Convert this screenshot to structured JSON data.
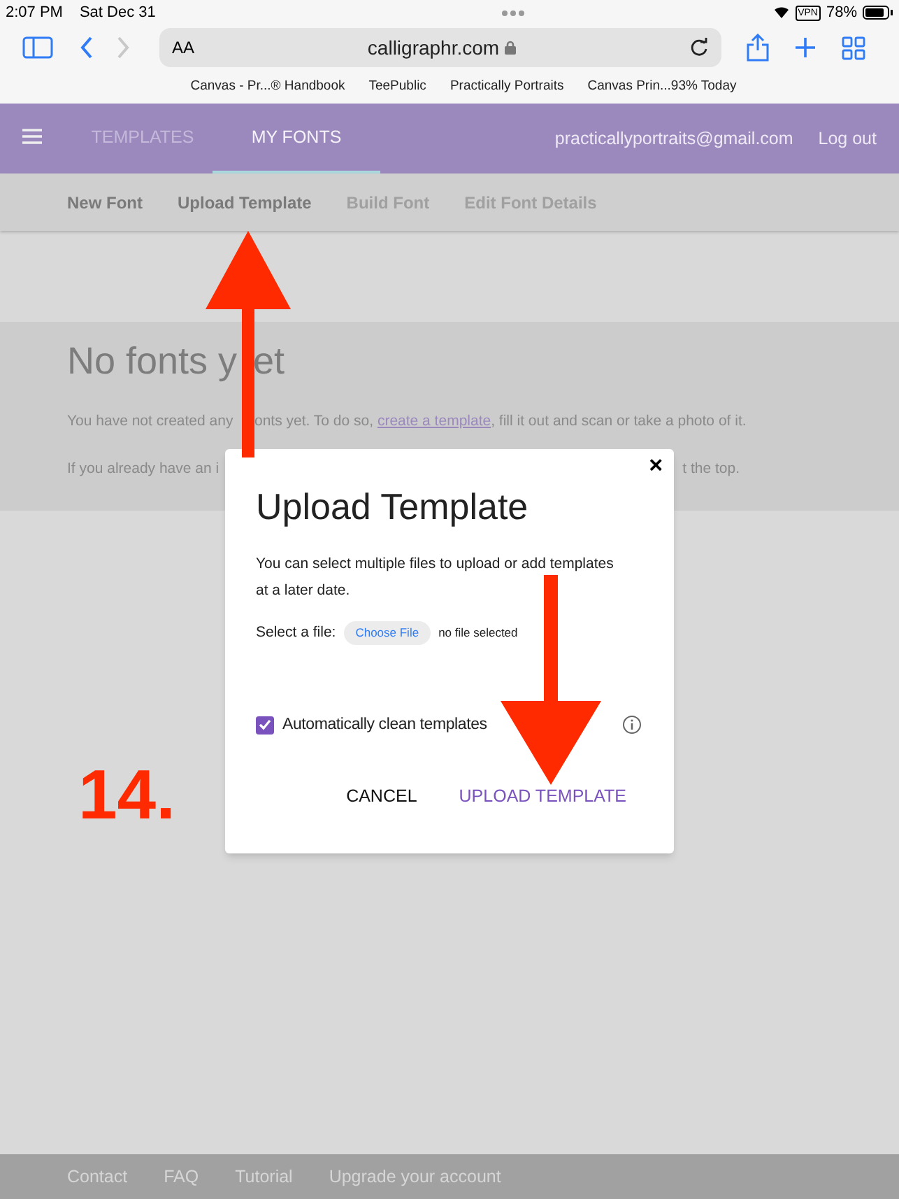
{
  "status_bar": {
    "time": "2:07 PM",
    "date": "Sat Dec 31",
    "vpn": "VPN",
    "battery": "78%"
  },
  "browser": {
    "text_size": "AA",
    "url": "calligraphr.com",
    "bookmarks": [
      "Canvas - Pr...® Handbook",
      "TeePublic",
      "Practically Portraits",
      "Canvas Prin...93% Today"
    ]
  },
  "nav": {
    "tabs": [
      {
        "label": "TEMPLATES",
        "selected": false
      },
      {
        "label": "MY FONTS",
        "selected": true
      }
    ],
    "email": "practicallyportraits@gmail.com",
    "logout": "Log out"
  },
  "subnav": [
    {
      "label": "New Font",
      "disabled": false
    },
    {
      "label": "Upload Template",
      "disabled": false
    },
    {
      "label": "Build Font",
      "disabled": true
    },
    {
      "label": "Edit Font Details",
      "disabled": true
    }
  ],
  "empty_state": {
    "heading_start": "No fonts y",
    "heading_end": "et",
    "line_1_start": "You have not created any",
    "line_1_before": "onts yet. To do so, ",
    "line_1_link": "create a template",
    "line_1_after": ", fill it out and scan or take a photo of it.",
    "line_2_start": "If you already have an i",
    "line_2_end": "t the top."
  },
  "dialog": {
    "close": "×",
    "title": "Upload Template",
    "description": "You can select multiple files to upload or add templates at a later date.",
    "file_label": "Select a file:",
    "file_button": "Choose File",
    "file_status": "no file selected",
    "auto_clean": {
      "label": "Automatically clean templates",
      "checked": true
    },
    "buttons": [
      {
        "label": "CANCEL",
        "kind": "plain"
      },
      {
        "label": "UPLOAD TEMPLATE",
        "kind": "primary"
      }
    ]
  },
  "step_label": "14.",
  "footer": [
    "Contact",
    "FAQ",
    "Tutorial",
    "Upgrade your account"
  ]
}
